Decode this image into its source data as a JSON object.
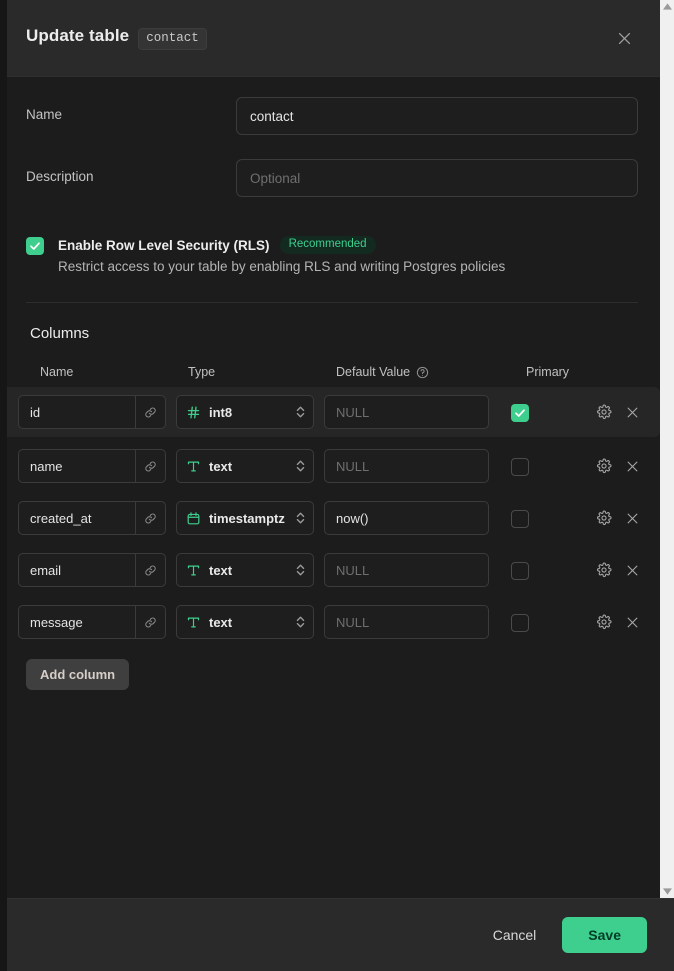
{
  "header": {
    "title": "Update table",
    "table_badge": "contact",
    "close_icon": "close-icon"
  },
  "form": {
    "name_label": "Name",
    "name_value": "contact",
    "description_label": "Description",
    "description_value": "",
    "description_placeholder": "Optional"
  },
  "rls": {
    "checked": true,
    "title": "Enable Row Level Security (RLS)",
    "pill": "Recommended",
    "description": "Restrict access to your table by enabling RLS and writing Postgres policies"
  },
  "columns_section": {
    "title": "Columns",
    "headers": {
      "name": "Name",
      "type": "Type",
      "default_value": "Default Value",
      "primary": "Primary"
    },
    "add_column_label": "Add column",
    "rows": [
      {
        "name": "id",
        "type": "int8",
        "type_icon": "hash-icon",
        "default_value": "",
        "default_placeholder": "NULL",
        "primary": true,
        "highlighted": true
      },
      {
        "name": "name",
        "type": "text",
        "type_icon": "text-icon",
        "default_value": "",
        "default_placeholder": "NULL",
        "primary": false,
        "highlighted": false
      },
      {
        "name": "created_at",
        "type": "timestamptz",
        "type_icon": "calendar-icon",
        "default_value": "now()",
        "default_placeholder": "NULL",
        "primary": false,
        "highlighted": false
      },
      {
        "name": "email",
        "type": "text",
        "type_icon": "text-icon",
        "default_value": "",
        "default_placeholder": "NULL",
        "primary": false,
        "highlighted": false
      },
      {
        "name": "message",
        "type": "text",
        "type_icon": "text-icon",
        "default_value": "",
        "default_placeholder": "NULL",
        "primary": false,
        "highlighted": false
      }
    ]
  },
  "footer": {
    "cancel_label": "Cancel",
    "save_label": "Save"
  },
  "colors": {
    "accent": "#3ecf8e",
    "panel_bg": "#1c1c1c",
    "header_bg": "#2a2a2a",
    "field_border": "#3b3b3b"
  }
}
